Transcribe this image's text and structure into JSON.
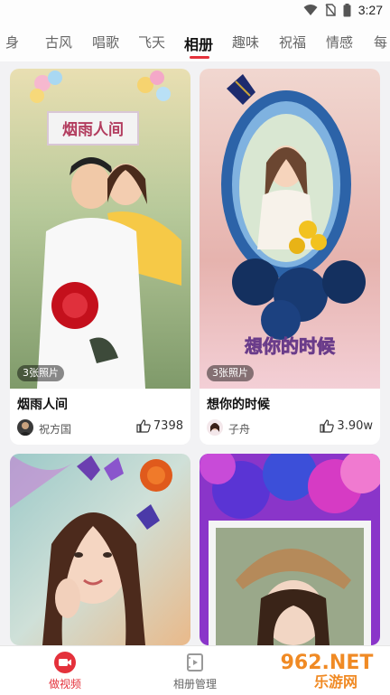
{
  "status_bar": {
    "time": "3:27"
  },
  "tabs": [
    {
      "label": "身"
    },
    {
      "label": "古风"
    },
    {
      "label": "唱歌"
    },
    {
      "label": "飞天"
    },
    {
      "label": "相册",
      "active": true
    },
    {
      "label": "趣味"
    },
    {
      "label": "祝福"
    },
    {
      "label": "情感"
    },
    {
      "label": "每"
    }
  ],
  "cards": [
    {
      "overlay_title": "烟雨人间",
      "photo_count": "3张照片",
      "title": "烟雨人间",
      "author": "祝方国",
      "likes": "7398"
    },
    {
      "overlay_title": "想你的时候",
      "photo_count": "3张照片",
      "title": "想你的时候",
      "author": "子舟",
      "likes": "3.90w"
    },
    {},
    {}
  ],
  "bottom_nav": [
    {
      "label": "做视频",
      "icon": "video-camera-icon",
      "active": true
    },
    {
      "label": "相册管理",
      "icon": "album-manage-icon"
    }
  ],
  "watermark": {
    "brand": "962.NET",
    "sub": "乐游网"
  },
  "colors": {
    "accent": "#e4313b",
    "watermark": "#f08a24"
  }
}
